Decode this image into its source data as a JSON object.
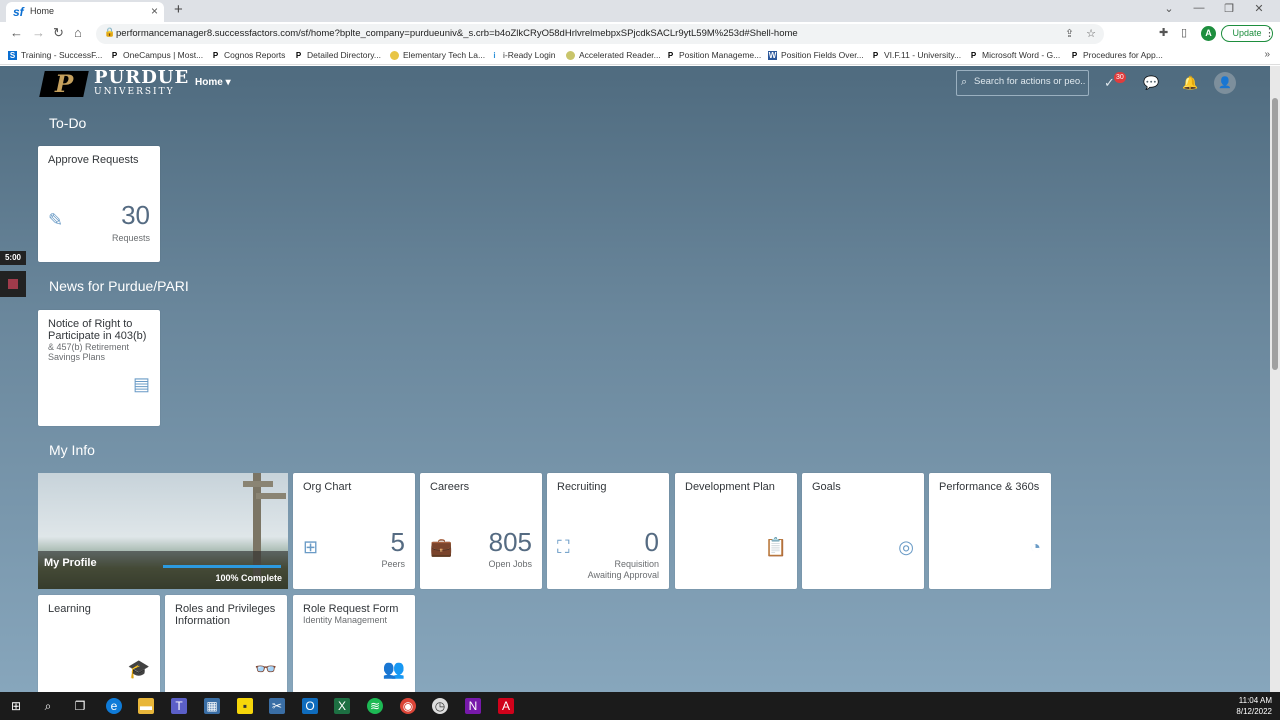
{
  "browser": {
    "tab_title": "Home",
    "tab_favicon": "sf",
    "url": "performancemanager8.successfactors.com/sf/home?bplte_company=purdueuniv&_s.crb=b4oZlkCRyO58dHrlvrelmebpxSPjcdkSACLr9ytL59M%253d#Shell-home",
    "profile_initial": "A",
    "update_label": "Update",
    "bookmarks": [
      {
        "label": "Training - SuccessF...",
        "icon": "S"
      },
      {
        "label": "OneCampus | Most...",
        "icon": "P"
      },
      {
        "label": "Cognos Reports",
        "icon": "P"
      },
      {
        "label": "Detailed Directory...",
        "icon": "P"
      },
      {
        "label": "Elementary Tech La...",
        "icon": "E"
      },
      {
        "label": "i-Ready Login",
        "icon": "i"
      },
      {
        "label": "Accelerated Reader...",
        "icon": "A"
      },
      {
        "label": "Position Manageme...",
        "icon": "P"
      },
      {
        "label": "Position Fields Over...",
        "icon": "W"
      },
      {
        "label": "VI.F.11 - University...",
        "icon": "P"
      },
      {
        "label": "Microsoft Word - G...",
        "icon": "P"
      },
      {
        "label": "Procedures for App...",
        "icon": "P"
      }
    ]
  },
  "shell": {
    "logo_purdue": "PURDUE",
    "logo_university": "UNIVERSITY",
    "home_menu": "Home",
    "search_placeholder": "Search for actions or peo...",
    "notification_count": "30"
  },
  "sections": {
    "todo": "To-Do",
    "news": "News for Purdue/PARI",
    "myinfo": "My Info"
  },
  "todo_tile": {
    "title": "Approve Requests",
    "number": "30",
    "unit": "Requests"
  },
  "news_tile": {
    "title": "Notice of Right to Participate in 403(b)",
    "subtitle": "& 457(b) Retirement Savings Plans"
  },
  "profile": {
    "name": "My Profile",
    "progress_label": "100% Complete",
    "progress": 1.0
  },
  "tiles": {
    "org_chart": {
      "title": "Org Chart",
      "number": "5",
      "unit": "Peers"
    },
    "careers": {
      "title": "Careers",
      "number": "805",
      "unit": "Open Jobs"
    },
    "recruiting": {
      "title": "Recruiting",
      "number": "0",
      "unit": "Requisition Awaiting Approval"
    },
    "dev_plan": {
      "title": "Development Plan"
    },
    "goals": {
      "title": "Goals"
    },
    "performance": {
      "title": "Performance & 360s"
    },
    "learning": {
      "title": "Learning"
    },
    "roles": {
      "title": "Roles and Privileges Information"
    },
    "role_request": {
      "title": "Role Request Form",
      "subtitle": "Identity Management"
    }
  },
  "overlay": {
    "timer": "5:00"
  },
  "taskbar": {
    "time": "11:04 AM",
    "date": "8/12/2022"
  }
}
